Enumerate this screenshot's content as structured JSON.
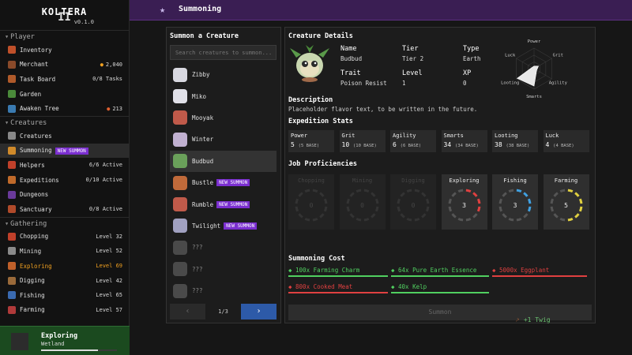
{
  "app": {
    "name": "KOLTERA",
    "logo_numeral": "II",
    "version": "v0.1.0"
  },
  "sidebar": {
    "sections": [
      {
        "title": "Player",
        "items": [
          {
            "label": "Inventory",
            "right": "",
            "icon": "backpack-icon",
            "color": "#c0502a"
          },
          {
            "label": "Merchant",
            "right": "2,040",
            "icon": "merchant-icon",
            "color": "#8a4a2a",
            "right_icon": "coin-icon"
          },
          {
            "label": "Task Board",
            "right": "0/8 Tasks",
            "icon": "task-board-icon",
            "color": "#b05a2a"
          },
          {
            "label": "Garden",
            "right": "",
            "icon": "garden-icon",
            "color": "#4a8a3a"
          },
          {
            "label": "Awaken Tree",
            "right": "213",
            "icon": "tree-icon",
            "color": "#3a7ab0",
            "right_icon": "gem-icon"
          }
        ]
      },
      {
        "title": "Creatures",
        "items": [
          {
            "label": "Creatures",
            "right": "",
            "icon": "creatures-icon",
            "color": "#888888"
          },
          {
            "label": "Summoning",
            "right": "",
            "icon": "summoning-star-icon",
            "color": "#d08a2a",
            "badge": "NEW SUMMON",
            "active": true
          },
          {
            "label": "Helpers",
            "right": "6/6 Active",
            "icon": "helpers-icon",
            "color": "#c0402a"
          },
          {
            "label": "Expeditions",
            "right": "0/10 Active",
            "icon": "expeditions-icon",
            "color": "#c06a2a"
          },
          {
            "label": "Dungeons",
            "right": "",
            "icon": "dungeons-icon",
            "color": "#6a3a9a"
          },
          {
            "label": "Sanctuary",
            "right": "0/8 Active",
            "icon": "sanctuary-icon",
            "color": "#b04a2a"
          }
        ]
      },
      {
        "title": "Gathering",
        "items": [
          {
            "label": "Chopping",
            "right": "Level 32",
            "icon": "axe-icon",
            "color": "#c0402a"
          },
          {
            "label": "Mining",
            "right": "Level 52",
            "icon": "pickaxe-icon",
            "color": "#8a8a8a"
          },
          {
            "label": "Exploring",
            "right": "Level 69",
            "icon": "compass-icon",
            "color": "#c0602a",
            "highlight": true
          },
          {
            "label": "Digging",
            "right": "Level 42",
            "icon": "shovel-icon",
            "color": "#9a6a3a"
          },
          {
            "label": "Fishing",
            "right": "Level 65",
            "icon": "fishing-rod-icon",
            "color": "#3a6ab0"
          },
          {
            "label": "Farming",
            "right": "Level 57",
            "icon": "farming-icon",
            "color": "#b03a3a"
          }
        ]
      }
    ],
    "current_activity": {
      "title": "Exploring",
      "location": "Wetland",
      "progress": 0.75
    }
  },
  "header": {
    "title": "Summoning"
  },
  "summon_list": {
    "title": "Summon a Creature",
    "search_placeholder": "Search creatures to summon...",
    "creatures": [
      {
        "name": "Zibby",
        "color": "#d8d8e0"
      },
      {
        "name": "Miko",
        "color": "#e0e0e8"
      },
      {
        "name": "Mooyak",
        "color": "#c05a4a"
      },
      {
        "name": "Winter",
        "color": "#c0b0d0"
      },
      {
        "name": "Budbud",
        "color": "#6aa05a",
        "selected": true
      },
      {
        "name": "Bustle",
        "color": "#c06a3a",
        "badge": "NEW SUMMON"
      },
      {
        "name": "Rumble",
        "color": "#c05a4a",
        "badge": "NEW SUMMON"
      },
      {
        "name": "Twilight",
        "color": "#a0a0c0",
        "badge": "NEW SUMMON"
      },
      {
        "name": "???",
        "color": "#4a4a4a",
        "locked": true
      },
      {
        "name": "???",
        "color": "#4a4a4a",
        "locked": true
      },
      {
        "name": "???",
        "color": "#4a4a4a",
        "locked": true
      }
    ],
    "pager": {
      "prev": "‹",
      "page": "1/3",
      "next": "›"
    }
  },
  "details": {
    "title": "Creature Details",
    "fields": {
      "name_label": "Name",
      "name_value": "Budbud",
      "tier_label": "Tier",
      "tier_value": "Tier 2",
      "type_label": "Type",
      "type_value": "Earth",
      "trait_label": "Trait",
      "trait_value": "Poison Resist",
      "level_label": "Level",
      "level_value": "1",
      "xp_label": "XP",
      "xp_value": "0"
    },
    "radar": {
      "axes": [
        "Power",
        "Grit",
        "Agility",
        "Smarts",
        "Looting",
        "Luck"
      ],
      "values": [
        5,
        10,
        6,
        34,
        38,
        4
      ],
      "max": 40
    },
    "description_title": "Description",
    "description": "Placeholder flavor text, to be written in the future.",
    "stats_title": "Expedition Stats",
    "stats": [
      {
        "name": "Power",
        "value": "5",
        "base": "(5 BASE)"
      },
      {
        "name": "Grit",
        "value": "10",
        "base": "(10 BASE)"
      },
      {
        "name": "Agility",
        "value": "6",
        "base": "(6 BASE)"
      },
      {
        "name": "Smarts",
        "value": "34",
        "base": "(34 BASE)"
      },
      {
        "name": "Looting",
        "value": "38",
        "base": "(38 BASE)"
      },
      {
        "name": "Luck",
        "value": "4",
        "base": "(4 BASE)"
      }
    ],
    "jobs_title": "Job Proficiencies",
    "jobs": [
      {
        "name": "Chopping",
        "level": "0",
        "active": false,
        "color": "#3a3a3a",
        "fill": 0
      },
      {
        "name": "Mining",
        "level": "0",
        "active": false,
        "color": "#3a3a3a",
        "fill": 0
      },
      {
        "name": "Digging",
        "level": "0",
        "active": false,
        "color": "#3a3a3a",
        "fill": 0
      },
      {
        "name": "Exploring",
        "level": "3",
        "active": true,
        "color": "#e04040",
        "fill": 0.3
      },
      {
        "name": "Fishing",
        "level": "3",
        "active": true,
        "color": "#40a0e0",
        "fill": 0.3
      },
      {
        "name": "Farming",
        "level": "5",
        "active": true,
        "color": "#e0d040",
        "fill": 0.5
      }
    ],
    "cost_title": "Summoning Cost",
    "costs": [
      {
        "label": "100x Farming Charm",
        "color": "#50d060",
        "icon": "charm-icon"
      },
      {
        "label": "64x Pure Earth Essence",
        "color": "#50d060",
        "icon": "essence-icon"
      },
      {
        "label": "5000x Eggplant",
        "color": "#e04040",
        "icon": "eggplant-icon"
      },
      {
        "label": "800x Cooked Meat",
        "color": "#e04040",
        "icon": "meat-icon"
      },
      {
        "label": "40x Kelp",
        "color": "#50d060",
        "icon": "kelp-icon"
      }
    ],
    "summon_button": "Summon"
  },
  "toast": {
    "text": "+1 Twig"
  }
}
